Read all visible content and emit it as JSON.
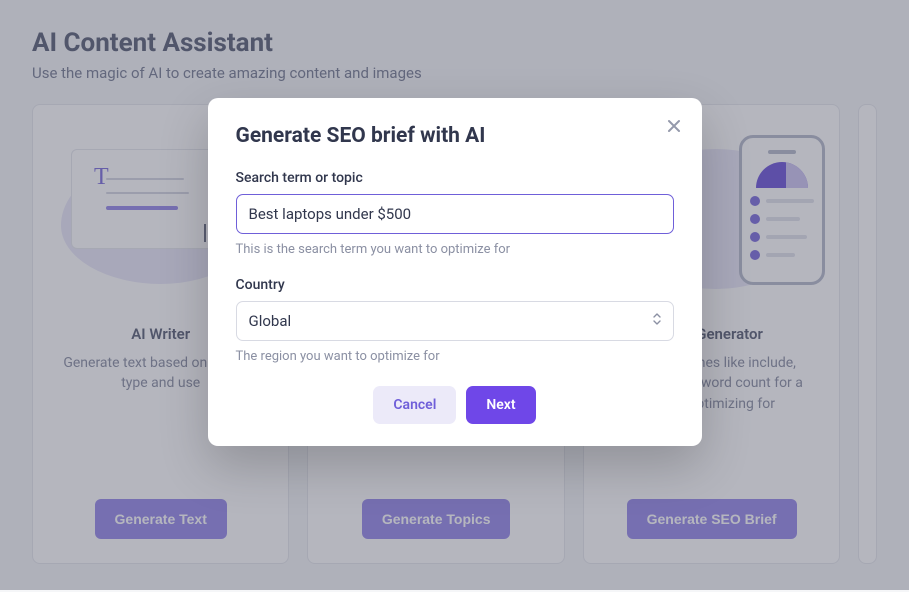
{
  "header": {
    "title": "AI Content Assistant",
    "subtitle": "Use the magic of AI to create amazing content and images"
  },
  "cards": [
    {
      "title": "AI Writer",
      "desc": "Generate text based on content type and use",
      "button": "Generate Text"
    },
    {
      "title": "",
      "desc": "",
      "button": "Generate Topics"
    },
    {
      "title": "Brief Generator",
      "desc": "SEO guidelines like include, questions to word count for a you're optimizing for",
      "button": "Generate SEO Brief"
    }
  ],
  "modal": {
    "title": "Generate SEO brief with AI",
    "search_label": "Search term or topic",
    "search_value": "Best laptops under $500",
    "search_hint": "This is the search term you want to optimize for",
    "country_label": "Country",
    "country_value": "Global",
    "country_hint": "The region you want to optimize for",
    "cancel": "Cancel",
    "next": "Next"
  }
}
